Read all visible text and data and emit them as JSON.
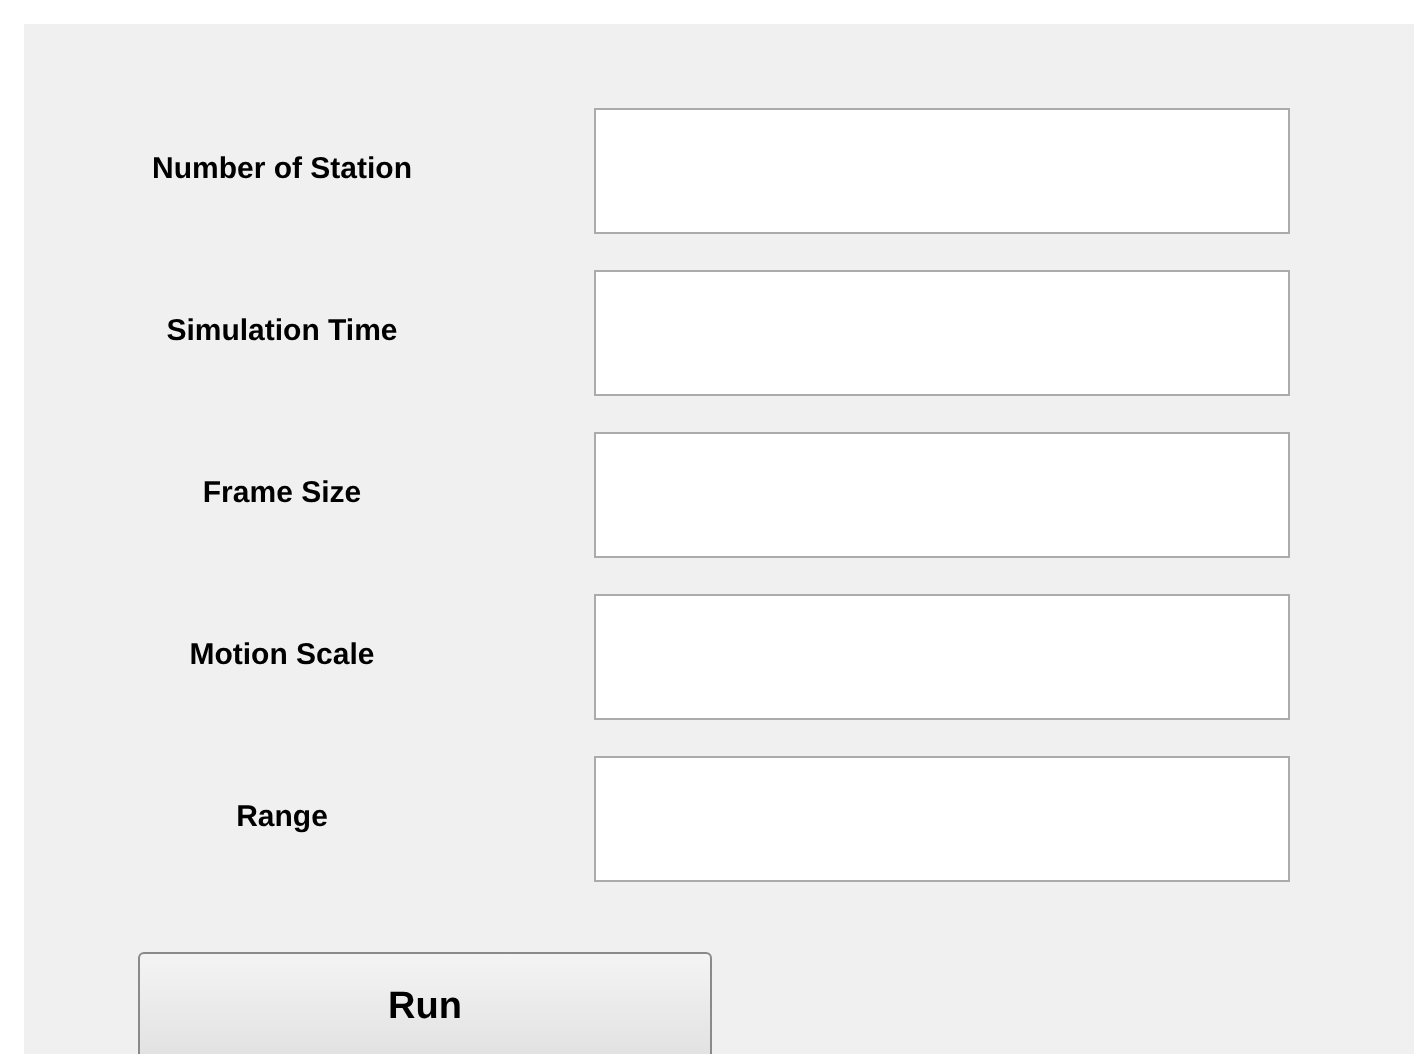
{
  "fields": [
    {
      "label": "Number of Station"
    },
    {
      "label": "Simulation Time"
    },
    {
      "label": "Frame Size"
    },
    {
      "label": "Motion Scale"
    },
    {
      "label": "Range"
    }
  ],
  "buttons": [
    {
      "label": "Run"
    }
  ]
}
